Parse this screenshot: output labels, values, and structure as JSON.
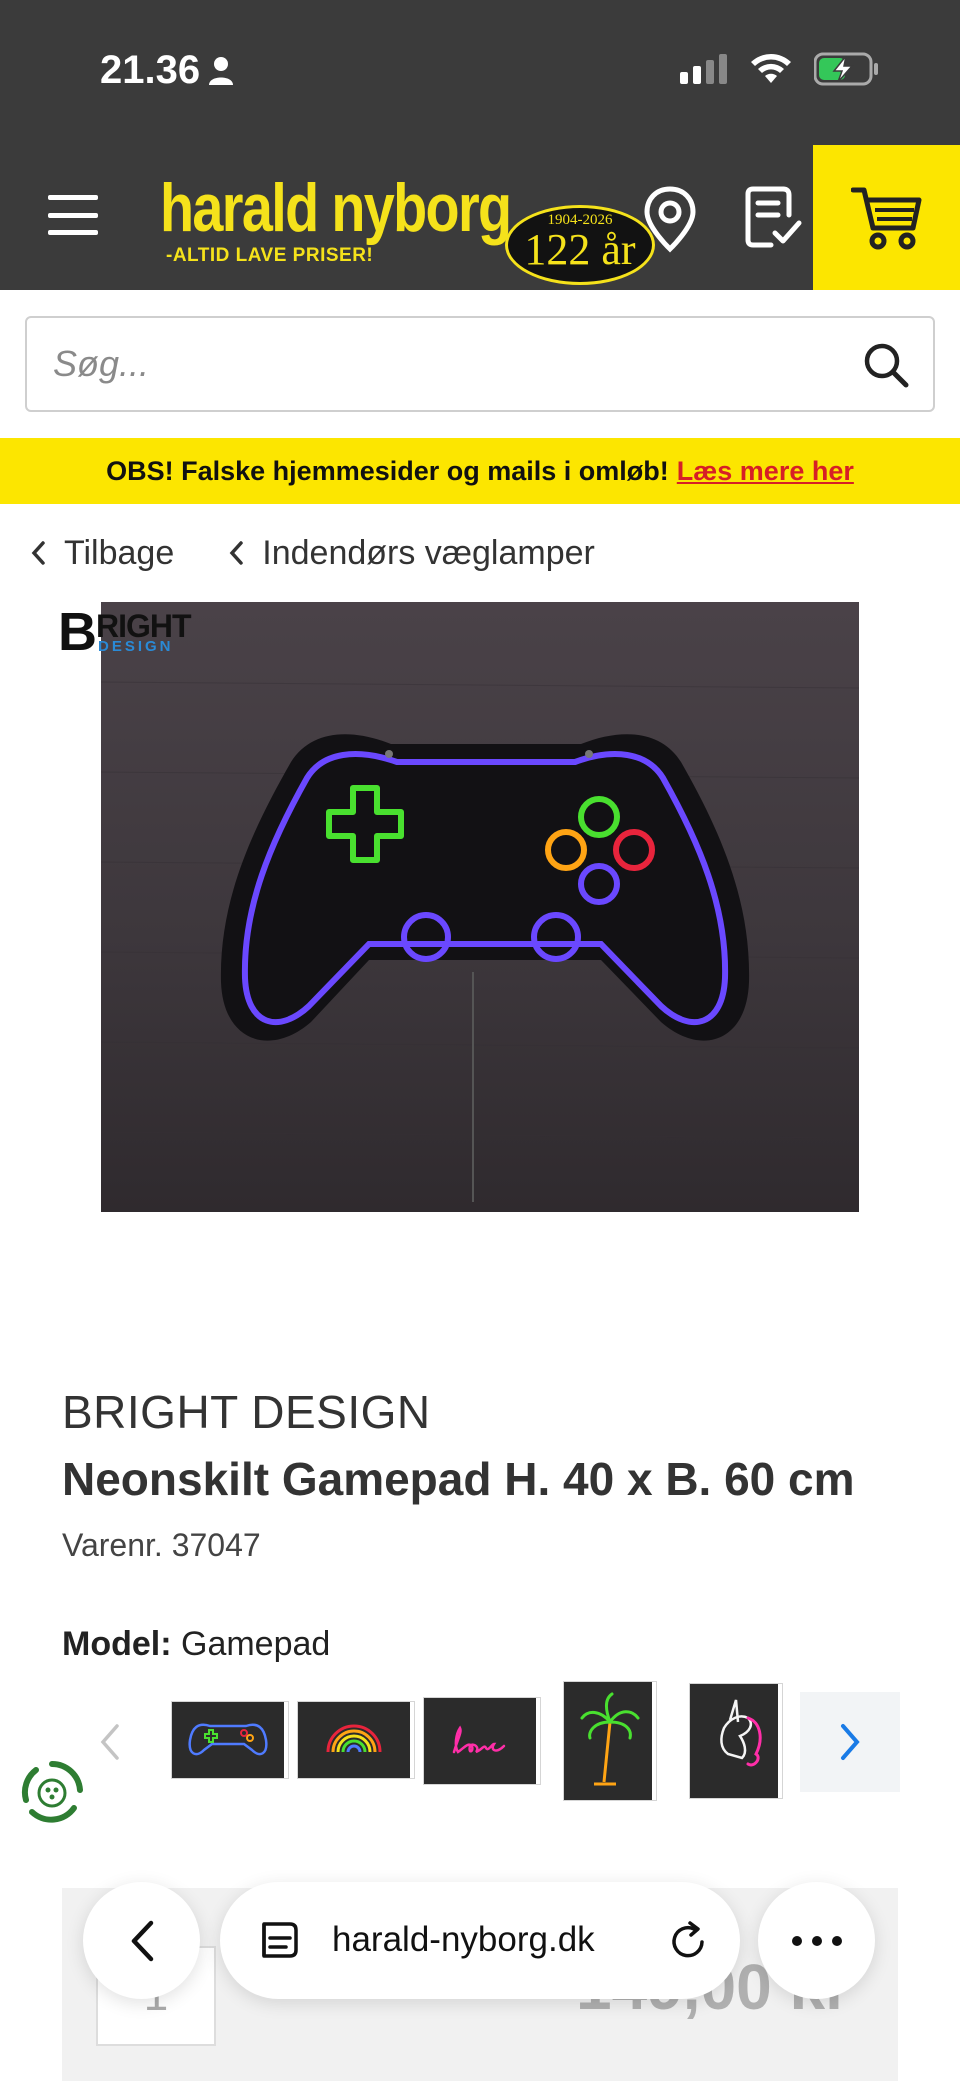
{
  "status": {
    "time": "21.36"
  },
  "header": {
    "logo_main": "harald nyborg",
    "logo_tagline": "-ALTID LAVE PRISER!",
    "badge_years": "1904-2026",
    "badge_number": "122 år"
  },
  "search": {
    "placeholder": "Søg..."
  },
  "notice": {
    "text": "OBS! Falske hjemmesider og mails i omløb!",
    "link": "Læs mere her"
  },
  "breadcrumbs": [
    {
      "label": "Tilbage"
    },
    {
      "label": "Indendørs væglamper"
    }
  ],
  "brand_logo": {
    "b": "B",
    "right": "RIGHT",
    "design": "DESIGN"
  },
  "product": {
    "brand": "BRIGHT DESIGN",
    "title": "Neonskilt Gamepad H. 40 x B. 60 cm",
    "sku": "Varenr. 37047",
    "model_label": "Model:",
    "model_value": "Gamepad"
  },
  "variants": [
    {
      "name": "Gamepad"
    },
    {
      "name": "Rainbow"
    },
    {
      "name": "Love"
    },
    {
      "name": "Palm"
    },
    {
      "name": "Unicorn"
    }
  ],
  "buy": {
    "quantity": "1",
    "price": "149,00 kr"
  },
  "browser": {
    "url": "harald-nyborg.dk"
  },
  "colors": {
    "brand_yellow": "#fce600",
    "header_dark": "#3b3b3b",
    "link_red": "#d61f26",
    "nav_blue": "#1a7be6",
    "battery_green": "#34c759"
  }
}
